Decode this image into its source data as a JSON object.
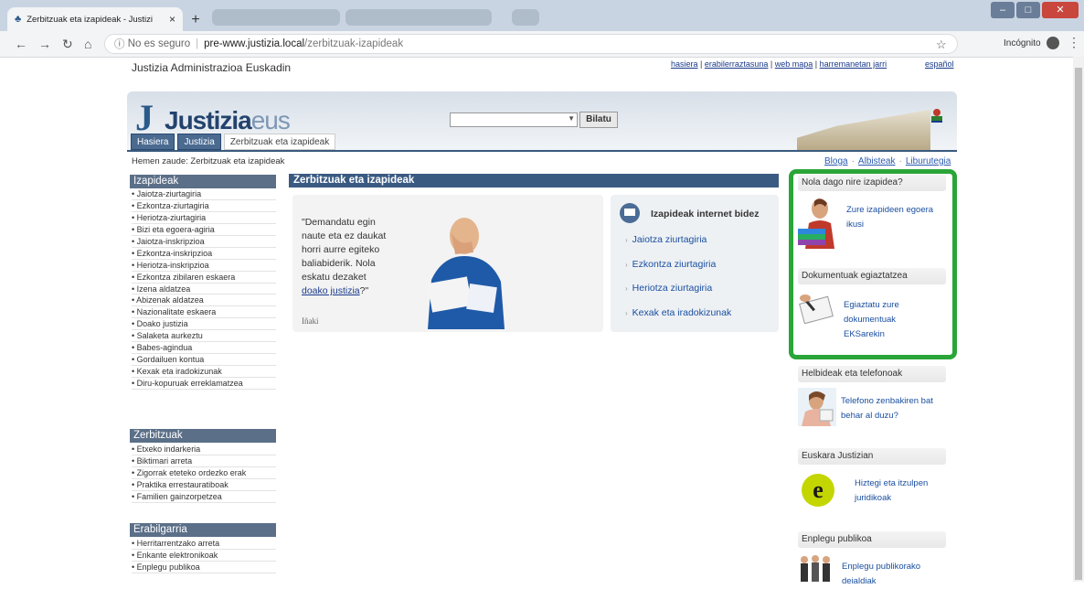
{
  "browser": {
    "tab_title": "Zerbitzuak eta izapideak - Justizi",
    "close_glyph": "×",
    "new_tab": "+",
    "address_prefix": "No es seguro",
    "address_host": "pre-www.justizia.local",
    "address_path": "/zerbitzuak-izapideak",
    "mode_label": "Incógnito"
  },
  "site": {
    "org_name": "Justizia Administrazioa Euskadin",
    "top_links": [
      "hasiera",
      "erabilerraztasuna",
      "web mapa",
      "harremanetan jarri"
    ],
    "language_link": "español",
    "logo_main": "Justizia",
    "logo_suffix": "eus",
    "search_button": "Bilatu",
    "nav_tabs": [
      "Hasiera",
      "Justizia",
      "Zerbitzuak eta izapideak"
    ],
    "breadcrumb": "Hemen zaude: Zerbitzuak eta izapideak",
    "right_links": [
      "Bloga",
      "Albisteak",
      "Liburutegia"
    ]
  },
  "sidebar": {
    "izapideak": {
      "title": "Izapideak",
      "items": [
        "Jaiotza-ziurtagiria",
        "Ezkontza-ziurtagiria",
        "Heriotza-ziurtagiria",
        "Bizi eta egoera-agiria",
        "Jaiotza-inskripzioa",
        "Ezkontza-inskripzioa",
        "Heriotza-inskripzioa",
        "Ezkontza zibilaren eskaera",
        "Izena aldatzea",
        "Abizenak aldatzea",
        "Nazionalitate eskaera",
        "Doako justizia",
        "Salaketa aurkeztu",
        "Babes-agindua",
        "Gordailuen kontua",
        "Kexak eta iradokizunak",
        "Diru-kopuruak erreklamatzea"
      ]
    },
    "zerbitzuak": {
      "title": "Zerbitzuak",
      "items": [
        "Etxeko indarkeria",
        "Biktimari arreta",
        "Zigorrak eteteko ordezko erak",
        "Praktika errestauratiboak",
        "Familien gainzorpetzea"
      ]
    },
    "erabilgarria": {
      "title": "Erabilgarria",
      "items": [
        "Herritarrentzako arreta",
        "Enkante elektronikoak",
        "Enplegu publikoa"
      ]
    }
  },
  "main": {
    "title": "Zerbitzuak eta izapideak",
    "quote_text": "\"Demandatu egin naute eta ez daukat horri aurre egiteko baliabiderik. Nola eskatu dezaket",
    "quote_link": "doako justizia",
    "quote_end": "?\"",
    "quote_signature": "Iñaki",
    "internet_title": "Izapideak internet bidez",
    "internet_links": [
      "Jaiotza ziurtagiria",
      "Ezkontza ziurtagiria",
      "Heriotza ziurtagiria",
      "Kexak eta iradokizunak"
    ]
  },
  "right": {
    "box1": {
      "title": "Nola dago nire izapidea?",
      "link": "Zure izapideen egoera ikusi"
    },
    "box2": {
      "title": "Dokumentuak egiaztatzea",
      "link": "Egiaztatu zure dokumentuak EKSarekin"
    },
    "box3": {
      "title": "Helbideak eta telefonoak",
      "link": "Telefono zenbakiren bat behar al duzu?"
    },
    "box4": {
      "title": "Euskara Justizian",
      "link": "Hiztegi eta itzulpen juridikoak"
    },
    "box5": {
      "title": "Enplegu publikoa",
      "link": "Enplegu publikorako deialdiak"
    },
    "highlight_color": "#2aa538"
  }
}
